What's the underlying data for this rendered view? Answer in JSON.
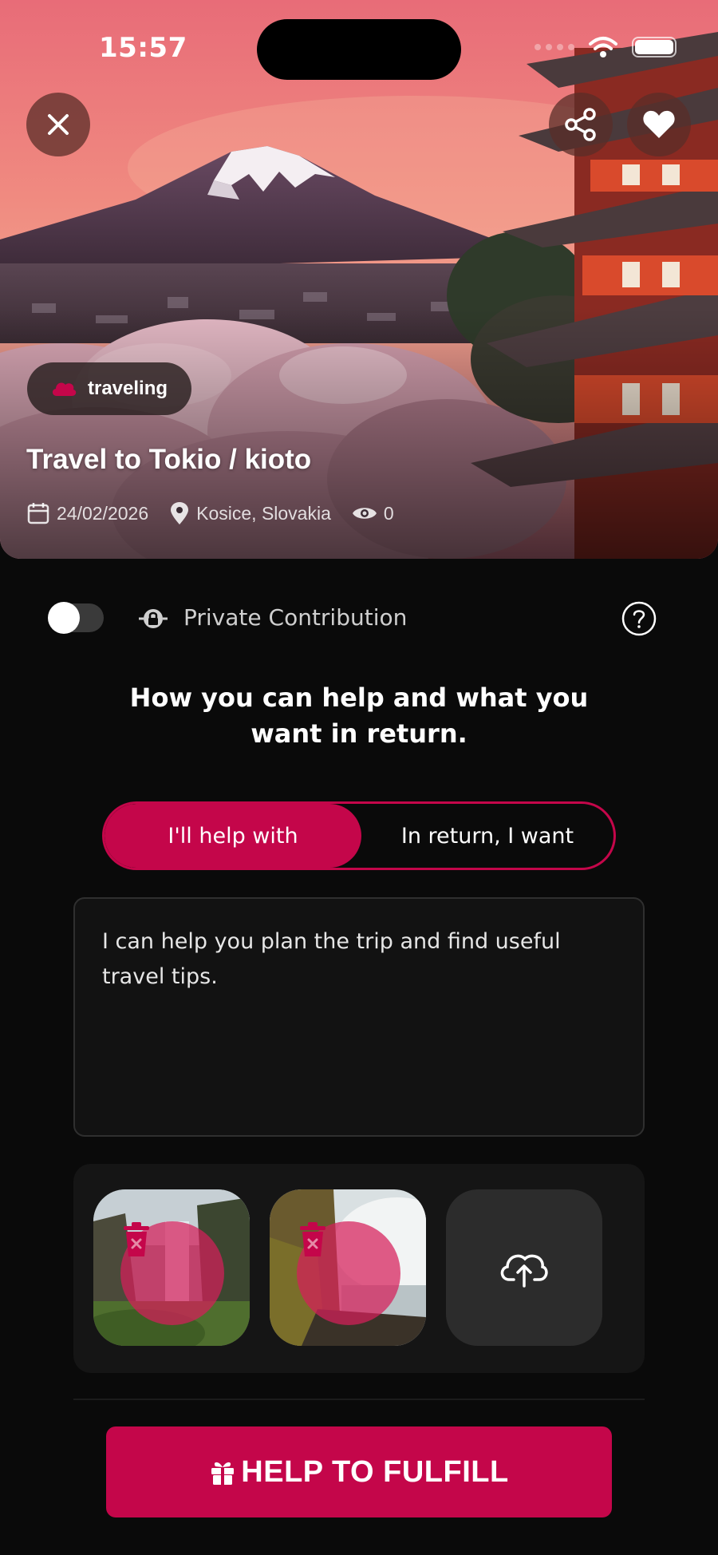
{
  "status_bar": {
    "time": "15:57"
  },
  "hero": {
    "category_tag": "traveling",
    "title": "Travel to Tokio / kioto",
    "date": "24/02/2026",
    "location": "Kosice, Slovakia",
    "views": "0",
    "icons": {
      "close": "close-icon",
      "share": "share-icon",
      "favorite": "heart-icon"
    }
  },
  "private_toggle": {
    "label": "Private Contribution",
    "enabled": false
  },
  "section": {
    "title": "How you can help and what you want in return."
  },
  "segments": {
    "help_with": "I'll help with",
    "in_return": "In return, I want",
    "active": "help_with"
  },
  "contribution_text": "I can help you plan the trip and find useful travel tips.",
  "images": [
    {
      "name": "waterfall-cliff-photo"
    },
    {
      "name": "coastal-mist-photo"
    }
  ],
  "cta": {
    "label": "HELP TO FULFILL"
  },
  "colors": {
    "accent": "#c4064a",
    "background": "#0a0a0a"
  }
}
